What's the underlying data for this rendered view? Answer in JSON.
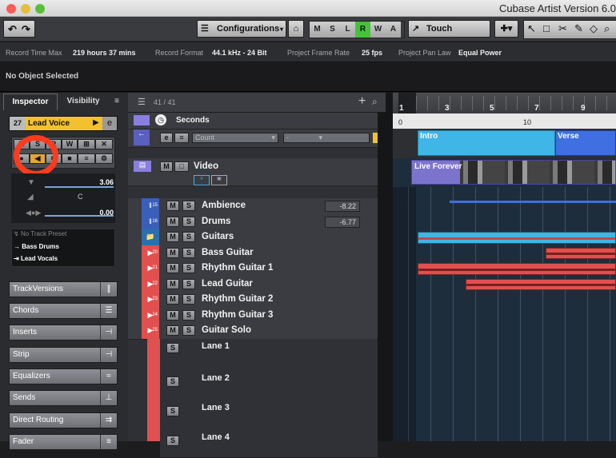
{
  "window": {
    "title": "Cubase Artist Version 6.0",
    "traffic_lights": {
      "close": "#fc5b57",
      "minimize": "#e5bf3c",
      "zoom": "#57c038"
    }
  },
  "toolbar": {
    "undo_icon": "undo-icon",
    "redo_icon": "redo-icon",
    "configurations_label": "Configurations",
    "modes": [
      "M",
      "S",
      "L",
      "R",
      "W",
      "A"
    ],
    "touch_label": "Touch"
  },
  "info_line": {
    "record_time_max_label": "Record Time Max",
    "record_time_max_value": "219 hours 37 mins",
    "record_format_label": "Record Format",
    "record_format_value": "44.1 kHz - 24 Bit",
    "frame_rate_label": "Project Frame Rate",
    "frame_rate_value": "25 fps",
    "pan_law_label": "Project Pan Law",
    "pan_law_value": "Equal Power"
  },
  "object_line": {
    "text": "No Object Selected"
  },
  "inspector": {
    "tab_inspector": "Inspector",
    "tab_visibility": "Visibility",
    "track_number": "27",
    "track_name": "Lead Voice",
    "volume_value": "3.06",
    "pan_value": "C",
    "delay_value": "0.00",
    "track_preset": "No Track Preset",
    "routing_1": "Bass Drums",
    "routing_2": "Lead Vocals",
    "sections": [
      "TrackVersions",
      "Chords",
      "Inserts",
      "Strip",
      "Equalizers",
      "Sends",
      "Direct Routing",
      "Fader"
    ],
    "highlight_color": "#ff3b1f"
  },
  "tracklist": {
    "count": "41 / 41",
    "ruler_track": "Seconds",
    "marker_track": "Count",
    "marker_dash": "-",
    "video_track": "Video",
    "tracks": [
      {
        "num": "15",
        "name": "Ambience",
        "vol": "-8.22"
      },
      {
        "num": "16",
        "name": "Drums",
        "vol": "-6.77"
      },
      {
        "num": "",
        "name": "Guitars",
        "vol": ""
      },
      {
        "num": "20",
        "name": "Bass Guitar",
        "vol": ""
      },
      {
        "num": "21",
        "name": "Rhythm Guitar 1",
        "vol": ""
      },
      {
        "num": "22",
        "name": "Lead Guitar",
        "vol": ""
      },
      {
        "num": "23",
        "name": "Rhythm Guitar 2",
        "vol": ""
      },
      {
        "num": "24",
        "name": "Rhythm Guitar 3",
        "vol": ""
      },
      {
        "num": "25",
        "name": "Guitar Solo",
        "vol": ""
      }
    ],
    "lanes": [
      "Lane 1",
      "Lane 2",
      "Lane 3",
      "Lane 4"
    ],
    "mute": "M",
    "solo": "S"
  },
  "arrange": {
    "bars": [
      "1",
      "3",
      "5",
      "7",
      "9"
    ],
    "seconds_marks": [
      "0",
      "10"
    ],
    "markers": [
      "Intro",
      "Verse"
    ],
    "video_clip": "Live Forever",
    "colors": {
      "marker": "#3fb6e6",
      "audio": "#e0504f",
      "folder": "#3fb6e6",
      "video": "#8a7ee0"
    }
  }
}
